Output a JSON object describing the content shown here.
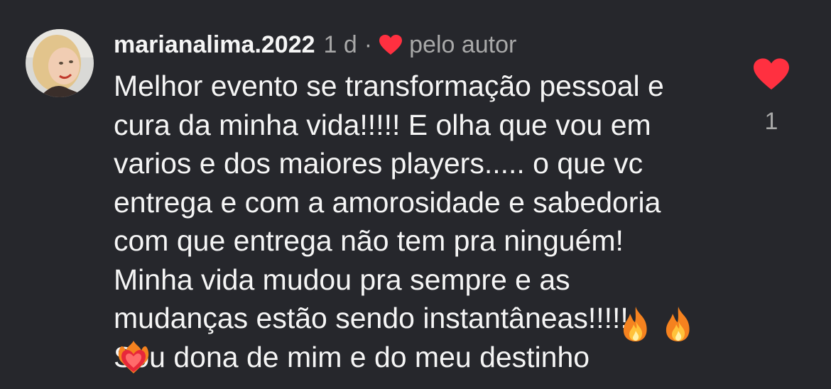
{
  "comment": {
    "username": "marianalima.2022",
    "time_ago": "1 d",
    "separator": "·",
    "author_liked_label": "pelo autor",
    "text": "Melhor evento se transformação pessoal e\ncura da minha vida!!!!! E olha que vou em\nvarios e dos maiores players..... o que vc\nentrega e com a amorosidade e sabedoria\ncom que entrega não tem pra ninguém!\nMinha vida mudou pra sempre e as\nmudanças estão sendo instantâneas!!!!!\nSou dona de mim e do meu destinho",
    "emojis": [
      "fire",
      "fire",
      "heart-on-fire"
    ],
    "like_count": "1"
  },
  "colors": {
    "background": "#26272c",
    "text_primary": "#f5f5f5",
    "text_secondary": "#a8a8a8",
    "like_red": "#ff3040"
  },
  "icons": {
    "author_like": "heart-icon",
    "like_button": "heart-icon"
  }
}
